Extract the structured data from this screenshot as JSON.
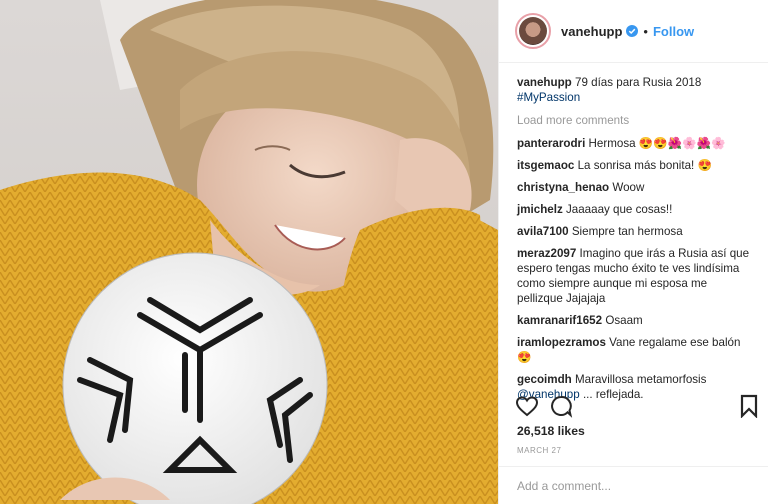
{
  "post": {
    "username": "vanehupp",
    "follow_label": "Follow",
    "separator": "•",
    "caption_text": "79 días para Rusia 2018",
    "hashtag": "#MyPassion",
    "load_more": "Load more comments",
    "comments": [
      {
        "user": "panterarodri",
        "text": "Hermosa 😍😍🌺🌸🌺🌸"
      },
      {
        "user": "itsgemaoc",
        "text": "La sonrisa más bonita! 😍"
      },
      {
        "user": "christyna_henao",
        "text": "Woow"
      },
      {
        "user": "jmichelz",
        "text": "Jaaaaay que cosas!!"
      },
      {
        "user": "avila7100",
        "text": "Siempre tan hermosa"
      },
      {
        "user": "meraz2097",
        "text": "Imagino que irás a Rusia así que espero tengas mucho éxito te ves lindísima como siempre aunque mi esposa me pellizque Jajajaja"
      },
      {
        "user": "kamranarif1652",
        "text": "Osaam"
      },
      {
        "user": "iramlopezramos",
        "text": "Vane regalame ese balón 😍"
      },
      {
        "user": "gecoimdh",
        "text": "Maravillosa metamorfosis",
        "mention": "@vanehupp",
        "tail": "... reflejada."
      }
    ],
    "likes": "26,518 likes",
    "date": "MARCH 27",
    "add_comment_placeholder": "Add a comment..."
  },
  "icons": {
    "avatar": "profile-avatar",
    "verified": "verified-badge-icon",
    "like": "heart-icon",
    "comment": "comment-icon",
    "save": "bookmark-icon"
  },
  "colors": {
    "link": "#3897f0",
    "hashtag": "#003569",
    "muted": "#999999",
    "text": "#262626",
    "sweater": "#e3ac2f"
  }
}
